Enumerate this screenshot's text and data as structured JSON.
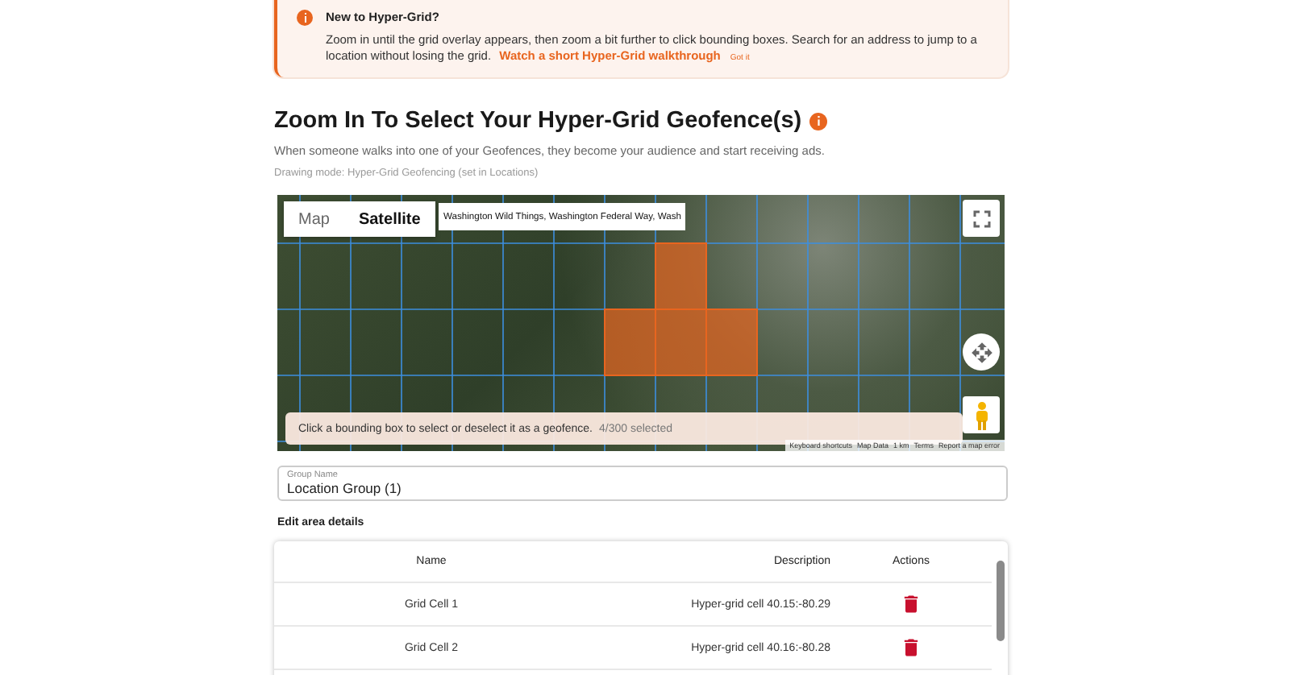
{
  "banner": {
    "title": "New to Hyper-Grid?",
    "body": "Zoom in until the grid overlay appears, then zoom a bit further to click bounding boxes. Search for an address to jump to a location without losing the grid.",
    "link": "Watch a short Hyper-Grid walkthrough",
    "dismiss": "Got it"
  },
  "heading": {
    "title": "Zoom In To Select Your Hyper-Grid Geofence(s)",
    "subtitle": "When someone walks into one of your Geofences, they become your audience and start receiving ads.",
    "mode_note": "Drawing mode: Hyper-Grid Geofencing (set in Locations)"
  },
  "map": {
    "map_types": [
      {
        "label": "Map",
        "selected": false
      },
      {
        "label": "Satellite",
        "selected": true
      }
    ],
    "search": {
      "value": "Washington Wild Things, Washington Federal Way, Wash"
    },
    "status": {
      "text": "Click a bounding box to select or deselect it as a geofence.",
      "count": "4/300 selected"
    },
    "attribution": [
      "Keyboard shortcuts",
      "Map Data",
      "1 km",
      "Terms",
      "Report a map error"
    ]
  },
  "group_name": {
    "label": "Group Name",
    "value": "Location Group (1)"
  },
  "section_title": "Edit area details",
  "table": {
    "columns": [
      "Name",
      "Description",
      "Actions"
    ],
    "rows": [
      {
        "name": "Grid Cell 1",
        "description": "Hyper-grid cell 40.15:-80.29"
      },
      {
        "name": "Grid Cell 2",
        "description": "Hyper-grid cell 40.16:-80.28"
      }
    ]
  }
}
